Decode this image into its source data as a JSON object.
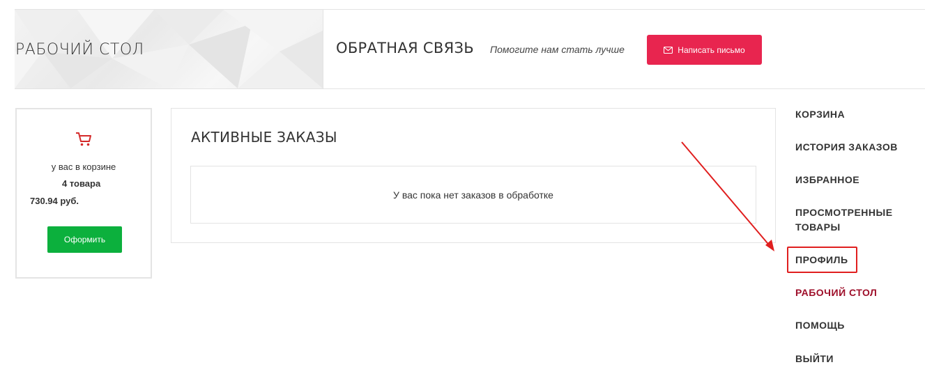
{
  "hero": {
    "title": "РАБОЧИЙ СТОЛ"
  },
  "feedback": {
    "title": "ОБРАТНАЯ СВЯЗЬ",
    "subtitle": "Помогите нам стать лучше",
    "button_label": "Написать письмо",
    "button_icon": "envelope-icon",
    "accent": "#e8254f"
  },
  "cart": {
    "icon": "cart-icon",
    "text": "у вас в корзине",
    "count": "4 товара",
    "price": "730.94 руб.",
    "checkout_label": "Оформить",
    "checkout_color": "#0cb03d"
  },
  "orders": {
    "title": "АКТИВНЫЕ ЗАКАЗЫ",
    "empty_text": "У вас пока нет заказов в обработке"
  },
  "sidebar": {
    "items": [
      {
        "label": "КОРЗИНА",
        "active": false
      },
      {
        "label": "ИСТОРИЯ ЗАКАЗОВ",
        "active": false
      },
      {
        "label": "ИЗБРАННОЕ",
        "active": false
      },
      {
        "label": "ПРОСМОТРЕННЫЕ ТОВАРЫ",
        "active": false
      },
      {
        "label": "ПРОФИЛЬ",
        "active": false,
        "highlighted": true
      },
      {
        "label": "РАБОЧИЙ СТОЛ",
        "active": true
      },
      {
        "label": "ПОМОЩЬ",
        "active": false
      },
      {
        "label": "ВЫЙТИ",
        "active": false
      }
    ],
    "active_color": "#9e0f2a",
    "highlight_color": "#e01e1e"
  }
}
